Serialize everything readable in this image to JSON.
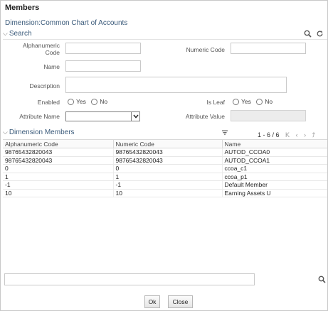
{
  "window": {
    "title": "Members"
  },
  "dimension": {
    "label": "Dimension:Common Chart of Accounts"
  },
  "search": {
    "section_label": "Search",
    "fields": {
      "alphanumeric_code_label": "Alphanumeric Code",
      "alphanumeric_code_value": "",
      "numeric_code_label": "Numeric Code",
      "numeric_code_value": "",
      "name_label": "Name",
      "name_value": "",
      "description_label": "Description",
      "description_value": "",
      "enabled_label": "Enabled",
      "enabled_yes": "Yes",
      "enabled_no": "No",
      "is_leaf_label": "Is Leaf",
      "is_leaf_yes": "Yes",
      "is_leaf_no": "No",
      "attribute_name_label": "Attribute Name",
      "attribute_name_value": "",
      "attribute_value_label": "Attribute Value",
      "attribute_value_value": ""
    },
    "icons": [
      "search-icon",
      "reset-icon"
    ]
  },
  "members": {
    "section_label": "Dimension Members",
    "pagination": {
      "range": "1 - 6 / 6"
    },
    "columns": [
      "Alphanumeric Code",
      "Numeric Code",
      "Name"
    ],
    "rows": [
      [
        "98765432820043",
        "98765432820043",
        "AUTOD_CCOA0"
      ],
      [
        "98765432820043",
        "98765432820043",
        "AUTOD_CCOA1"
      ],
      [
        "0",
        "0",
        "ccoa_c1"
      ],
      [
        "1",
        "1",
        "ccoa_p1"
      ],
      [
        "-1",
        "-1",
        "Default Member"
      ],
      [
        "10",
        "10",
        "Earning Assets U"
      ]
    ]
  },
  "bottom_search": {
    "value": ""
  },
  "footer": {
    "ok_label": "Ok",
    "close_label": "Close"
  }
}
